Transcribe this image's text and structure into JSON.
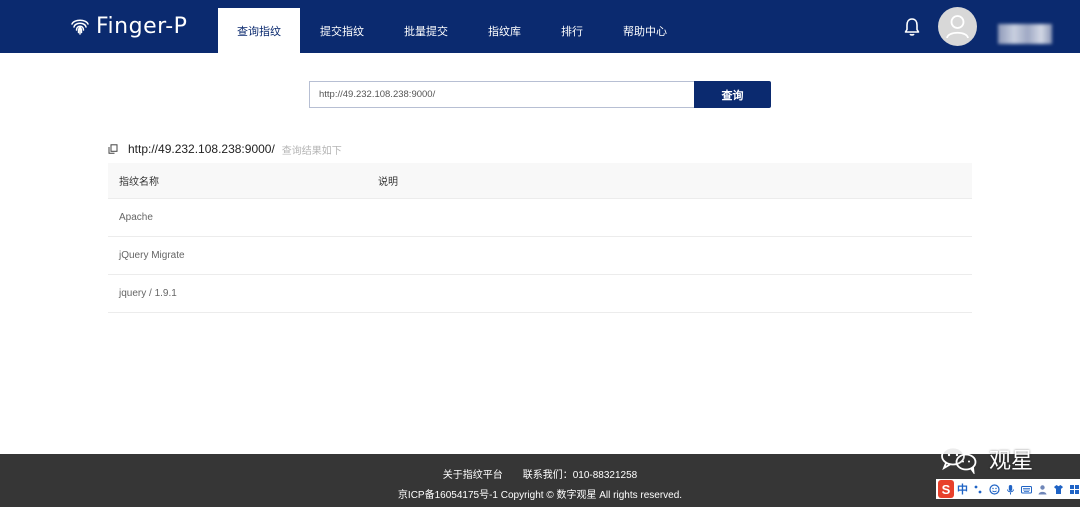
{
  "header": {
    "logo_text": "Finger-P",
    "nav": [
      {
        "label": "查询指纹",
        "active": true
      },
      {
        "label": "提交指纹",
        "active": false
      },
      {
        "label": "批量提交",
        "active": false
      },
      {
        "label": "指纹库",
        "active": false
      },
      {
        "label": "排行",
        "active": false
      },
      {
        "label": "帮助中心",
        "active": false
      }
    ],
    "icons": {
      "bell": "bell-icon",
      "avatar": "user-avatar-icon"
    }
  },
  "search": {
    "value": "http://49.232.108.238:9000/",
    "button_label": "查询"
  },
  "result": {
    "url": "http://49.232.108.238:9000/",
    "hint": "查询结果如下",
    "icon": "copy-icon"
  },
  "table": {
    "columns": [
      "指纹名称",
      "说明"
    ],
    "rows": [
      {
        "name": "Apache",
        "desc": ""
      },
      {
        "name": "jQuery Migrate",
        "desc": ""
      },
      {
        "name": "jquery / 1.9.1",
        "desc": ""
      }
    ]
  },
  "footer": {
    "about": "关于指纹平台",
    "contact": "联系我们：010-88321258",
    "copyright": "京ICP备16054175号-1  Copyright © 数字观星 All rights reserved."
  },
  "watermark": {
    "text": "观星",
    "icon": "wechat-icon"
  },
  "ime": {
    "logo": "S",
    "mode": "中",
    "icons": [
      "punctuation-icon",
      "emoji-icon",
      "microphone-icon",
      "keyboard-icon",
      "user-icon",
      "shirt-icon",
      "grid-icon"
    ]
  },
  "colors": {
    "primary": "#0b2a6f",
    "footer_bg": "#363636",
    "header_bg": "#0b2a6f"
  }
}
